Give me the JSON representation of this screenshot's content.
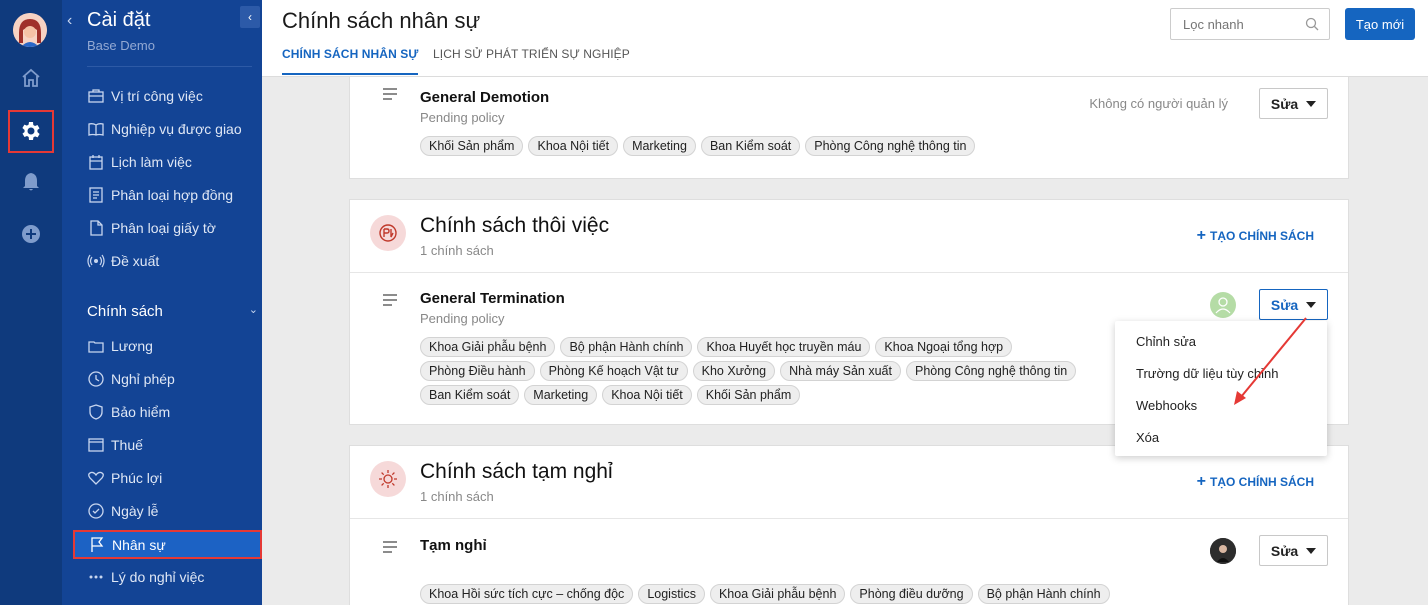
{
  "app": {
    "title": "Cài đặt",
    "subtitle": "Base Demo"
  },
  "rail": {
    "icons": [
      "avatar",
      "home-icon",
      "gear-icon",
      "bell-icon",
      "plus-circle-icon"
    ]
  },
  "sidebar": {
    "items": [
      {
        "label": "Vị trí công việc",
        "icon": "briefcase-icon"
      },
      {
        "label": "Nghiệp vụ được giao",
        "icon": "book-icon"
      },
      {
        "label": "Lịch làm việc",
        "icon": "calendar-icon"
      },
      {
        "label": "Phân loại hợp đồng",
        "icon": "contract-icon"
      },
      {
        "label": "Phân loại giấy tờ",
        "icon": "document-icon"
      },
      {
        "label": "Đề xuất",
        "icon": "broadcast-icon"
      }
    ],
    "section_label": "Chính sách",
    "policy_items": [
      {
        "label": "Lương",
        "icon": "folder-icon"
      },
      {
        "label": "Nghỉ phép",
        "icon": "clock-icon"
      },
      {
        "label": "Bảo hiểm",
        "icon": "shield-icon"
      },
      {
        "label": "Thuế",
        "icon": "window-icon"
      },
      {
        "label": "Phúc lợi",
        "icon": "heart-icon"
      },
      {
        "label": "Ngày lễ",
        "icon": "check-circle-icon"
      },
      {
        "label": "Nhân sự",
        "icon": "flag-icon",
        "active": true
      },
      {
        "label": "Lý do nghỉ việc",
        "icon": "dots-icon"
      }
    ]
  },
  "header": {
    "title": "Chính sách nhân sự",
    "tabs": [
      {
        "label": "CHÍNH SÁCH NHÂN SỰ",
        "active": true
      },
      {
        "label": "LỊCH SỬ PHÁT TRIỂN SỰ NGHIỆP",
        "active": false
      }
    ],
    "search_placeholder": "Lọc nhanh",
    "new_button": "Tạo mới"
  },
  "cards": {
    "demotion": {
      "name": "General Demotion",
      "status": "Pending policy",
      "manager": "Không có người quản lý",
      "edit_label": "Sửa",
      "tags": [
        "Khối Sản phẩm",
        "Khoa Nội tiết",
        "Marketing",
        "Ban Kiểm soát",
        "Phòng Công nghệ thông tin"
      ]
    },
    "termination": {
      "category_title": "Chính sách thôi việc",
      "category_count": "1 chính sách",
      "create_label": "TẠO CHÍNH SÁCH",
      "name": "General Termination",
      "status": "Pending policy",
      "edit_label": "Sửa",
      "tags": [
        "Khoa Giải phẫu bệnh",
        "Bộ phận Hành chính",
        "Khoa Huyết học truyền máu",
        "Khoa Ngoại tổng hợp",
        "Phòng Điều hành",
        "Phòng Kế hoạch Vật tư",
        "Kho Xưởng",
        "Nhà máy Sản xuất",
        "Phòng Công nghệ thông tin",
        "Ban Kiểm soát",
        "Marketing",
        "Khoa Nội tiết",
        "Khối Sản phẩm"
      ]
    },
    "leave": {
      "category_title": "Chính sách tạm nghỉ",
      "category_count": "1 chính sách",
      "create_label": "TẠO CHÍNH SÁCH",
      "name": "Tạm nghỉ",
      "edit_label": "Sửa",
      "tags": [
        "Khoa Hồi sức tích cực – chống độc",
        "Logistics",
        "Khoa Giải phẫu bệnh",
        "Phòng điều dưỡng",
        "Bộ phận Hành chính"
      ]
    }
  },
  "dropdown": {
    "options": [
      "Chỉnh sửa",
      "Trường dữ liệu tùy chỉnh",
      "Webhooks",
      "Xóa"
    ]
  },
  "colors": {
    "rail_bg": "#0f3a7d",
    "sidebar_bg": "#134495",
    "accent": "#1565c0",
    "highlight_box": "#e53935",
    "annotation_arrow": "#e53935"
  }
}
